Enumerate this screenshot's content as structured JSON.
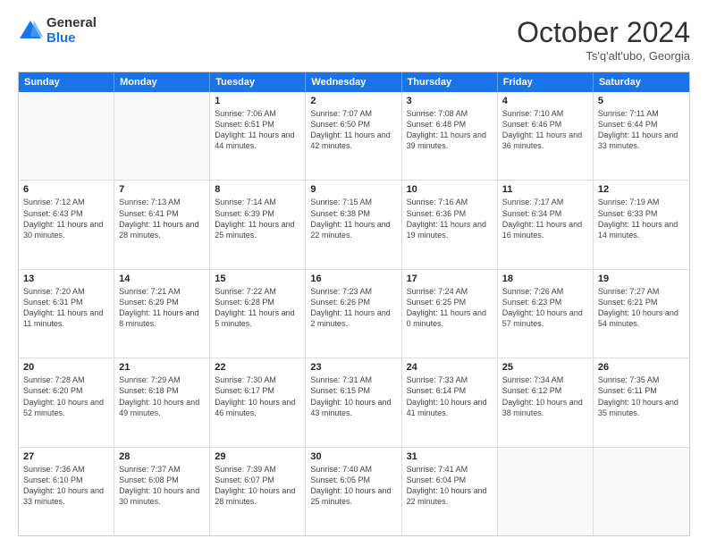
{
  "header": {
    "logo_general": "General",
    "logo_blue": "Blue",
    "month_title": "October 2024",
    "subtitle": "Ts'q'alt'ubo, Georgia"
  },
  "days_of_week": [
    "Sunday",
    "Monday",
    "Tuesday",
    "Wednesday",
    "Thursday",
    "Friday",
    "Saturday"
  ],
  "weeks": [
    [
      {
        "day": "",
        "text": ""
      },
      {
        "day": "",
        "text": ""
      },
      {
        "day": "1",
        "text": "Sunrise: 7:06 AM\nSunset: 6:51 PM\nDaylight: 11 hours and 44 minutes."
      },
      {
        "day": "2",
        "text": "Sunrise: 7:07 AM\nSunset: 6:50 PM\nDaylight: 11 hours and 42 minutes."
      },
      {
        "day": "3",
        "text": "Sunrise: 7:08 AM\nSunset: 6:48 PM\nDaylight: 11 hours and 39 minutes."
      },
      {
        "day": "4",
        "text": "Sunrise: 7:10 AM\nSunset: 6:46 PM\nDaylight: 11 hours and 36 minutes."
      },
      {
        "day": "5",
        "text": "Sunrise: 7:11 AM\nSunset: 6:44 PM\nDaylight: 11 hours and 33 minutes."
      }
    ],
    [
      {
        "day": "6",
        "text": "Sunrise: 7:12 AM\nSunset: 6:43 PM\nDaylight: 11 hours and 30 minutes."
      },
      {
        "day": "7",
        "text": "Sunrise: 7:13 AM\nSunset: 6:41 PM\nDaylight: 11 hours and 28 minutes."
      },
      {
        "day": "8",
        "text": "Sunrise: 7:14 AM\nSunset: 6:39 PM\nDaylight: 11 hours and 25 minutes."
      },
      {
        "day": "9",
        "text": "Sunrise: 7:15 AM\nSunset: 6:38 PM\nDaylight: 11 hours and 22 minutes."
      },
      {
        "day": "10",
        "text": "Sunrise: 7:16 AM\nSunset: 6:36 PM\nDaylight: 11 hours and 19 minutes."
      },
      {
        "day": "11",
        "text": "Sunrise: 7:17 AM\nSunset: 6:34 PM\nDaylight: 11 hours and 16 minutes."
      },
      {
        "day": "12",
        "text": "Sunrise: 7:19 AM\nSunset: 6:33 PM\nDaylight: 11 hours and 14 minutes."
      }
    ],
    [
      {
        "day": "13",
        "text": "Sunrise: 7:20 AM\nSunset: 6:31 PM\nDaylight: 11 hours and 11 minutes."
      },
      {
        "day": "14",
        "text": "Sunrise: 7:21 AM\nSunset: 6:29 PM\nDaylight: 11 hours and 8 minutes."
      },
      {
        "day": "15",
        "text": "Sunrise: 7:22 AM\nSunset: 6:28 PM\nDaylight: 11 hours and 5 minutes."
      },
      {
        "day": "16",
        "text": "Sunrise: 7:23 AM\nSunset: 6:26 PM\nDaylight: 11 hours and 2 minutes."
      },
      {
        "day": "17",
        "text": "Sunrise: 7:24 AM\nSunset: 6:25 PM\nDaylight: 11 hours and 0 minutes."
      },
      {
        "day": "18",
        "text": "Sunrise: 7:26 AM\nSunset: 6:23 PM\nDaylight: 10 hours and 57 minutes."
      },
      {
        "day": "19",
        "text": "Sunrise: 7:27 AM\nSunset: 6:21 PM\nDaylight: 10 hours and 54 minutes."
      }
    ],
    [
      {
        "day": "20",
        "text": "Sunrise: 7:28 AM\nSunset: 6:20 PM\nDaylight: 10 hours and 52 minutes."
      },
      {
        "day": "21",
        "text": "Sunrise: 7:29 AM\nSunset: 6:18 PM\nDaylight: 10 hours and 49 minutes."
      },
      {
        "day": "22",
        "text": "Sunrise: 7:30 AM\nSunset: 6:17 PM\nDaylight: 10 hours and 46 minutes."
      },
      {
        "day": "23",
        "text": "Sunrise: 7:31 AM\nSunset: 6:15 PM\nDaylight: 10 hours and 43 minutes."
      },
      {
        "day": "24",
        "text": "Sunrise: 7:33 AM\nSunset: 6:14 PM\nDaylight: 10 hours and 41 minutes."
      },
      {
        "day": "25",
        "text": "Sunrise: 7:34 AM\nSunset: 6:12 PM\nDaylight: 10 hours and 38 minutes."
      },
      {
        "day": "26",
        "text": "Sunrise: 7:35 AM\nSunset: 6:11 PM\nDaylight: 10 hours and 35 minutes."
      }
    ],
    [
      {
        "day": "27",
        "text": "Sunrise: 7:36 AM\nSunset: 6:10 PM\nDaylight: 10 hours and 33 minutes."
      },
      {
        "day": "28",
        "text": "Sunrise: 7:37 AM\nSunset: 6:08 PM\nDaylight: 10 hours and 30 minutes."
      },
      {
        "day": "29",
        "text": "Sunrise: 7:39 AM\nSunset: 6:07 PM\nDaylight: 10 hours and 28 minutes."
      },
      {
        "day": "30",
        "text": "Sunrise: 7:40 AM\nSunset: 6:05 PM\nDaylight: 10 hours and 25 minutes."
      },
      {
        "day": "31",
        "text": "Sunrise: 7:41 AM\nSunset: 6:04 PM\nDaylight: 10 hours and 22 minutes."
      },
      {
        "day": "",
        "text": ""
      },
      {
        "day": "",
        "text": ""
      }
    ]
  ]
}
